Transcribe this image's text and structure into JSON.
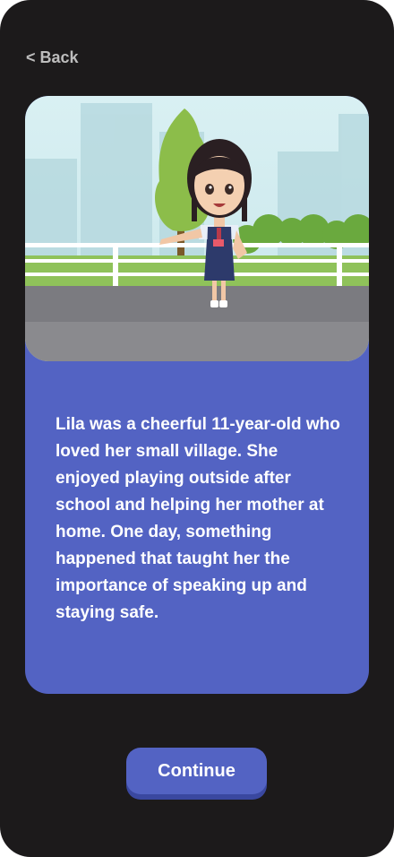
{
  "header": {
    "back_label": "< Back"
  },
  "story": {
    "text": "Lila was a cheerful 11-year-old who loved her small village. She enjoyed playing outside after school and helping her mother at home. One day, something happened that taught her the importance of speaking up and staying safe."
  },
  "actions": {
    "continue_label": "Continue"
  },
  "colors": {
    "background": "#1c1a1b",
    "card": "#5363c3",
    "back_text": "#bdbdbd",
    "text": "#ffffff"
  }
}
